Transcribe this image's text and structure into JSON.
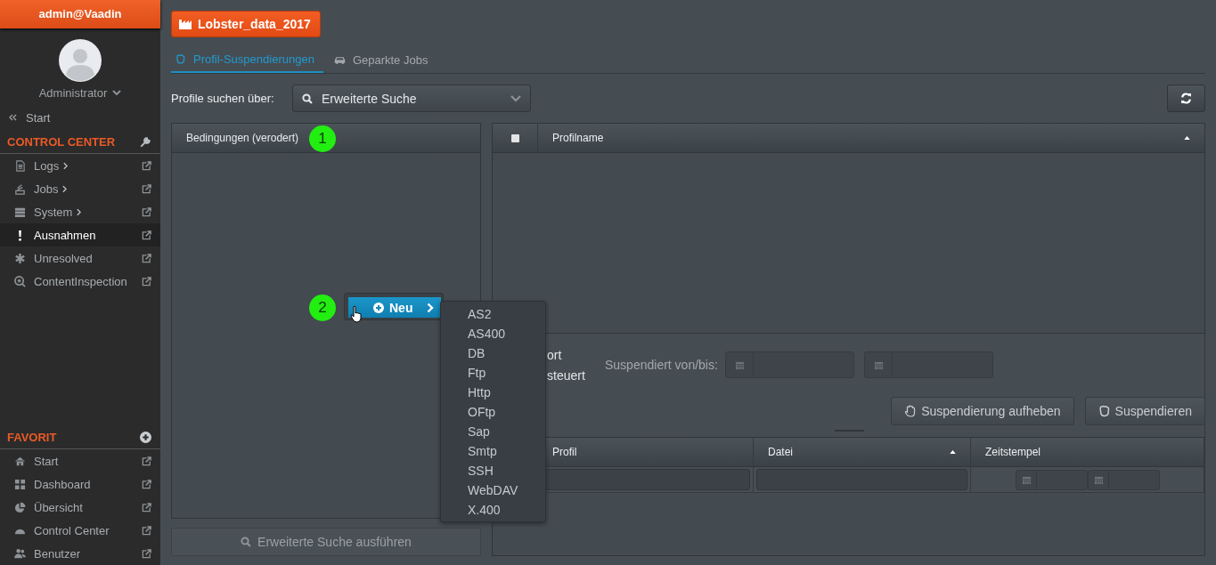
{
  "sidebar": {
    "user": "admin@Vaadin",
    "role": "Administrator",
    "back": "Start",
    "sections": [
      {
        "title": "CONTROL CENTER",
        "kind": "tools",
        "items": [
          {
            "label": "Logs",
            "submenu": true,
            "selected": false
          },
          {
            "label": "Jobs",
            "submenu": true,
            "selected": false
          },
          {
            "label": "System",
            "submenu": true,
            "selected": false
          },
          {
            "label": "Ausnahmen",
            "submenu": false,
            "selected": true
          },
          {
            "label": "Unresolved",
            "submenu": false,
            "selected": false
          },
          {
            "label": "ContentInspection",
            "submenu": false,
            "selected": false
          }
        ]
      },
      {
        "title": "FAVORIT",
        "kind": "favorites",
        "items": [
          {
            "label": "Start",
            "submenu": false,
            "selected": false
          },
          {
            "label": "Dashboard",
            "submenu": false,
            "selected": false
          },
          {
            "label": "Übersicht",
            "submenu": false,
            "selected": false
          },
          {
            "label": "Control Center",
            "submenu": false,
            "selected": false
          },
          {
            "label": "Benutzer",
            "submenu": false,
            "selected": false
          }
        ]
      }
    ]
  },
  "org_button": "Lobster_data_2017",
  "tabs": [
    {
      "label": "Profil-Suspendierungen",
      "selected": true
    },
    {
      "label": "Geparkte Jobs",
      "selected": false
    }
  ],
  "search": {
    "label": "Profile suchen über:",
    "value": "Erweiterte Suche"
  },
  "conditions": {
    "header": "Bedingungen (verodert)",
    "badge": "1",
    "new_button": "Neu",
    "new_badge": "2",
    "run_button": "Erweiterte Suche ausführen"
  },
  "menu": [
    "AS2",
    "AS400",
    "DB",
    "Ftp",
    "Http",
    "OFtp",
    "Sap",
    "Smtp",
    "SSH",
    "WebDAV",
    "X.400"
  ],
  "profiles_table": {
    "checked": false,
    "columns": [
      {
        "label": "Profilname",
        "sorted": true
      }
    ]
  },
  "options": {
    "radio_1": "ort",
    "radio_2": "steuert",
    "date_label": "Suspendiert von/bis:"
  },
  "buttons": [
    "Suspendierung aufheben",
    "Suspendieren"
  ],
  "jobs_table": {
    "columns": [
      {
        "label": "Profil",
        "sorted": false
      },
      {
        "label": "Datei",
        "sorted": true
      },
      {
        "label": "Zeitstempel",
        "sorted": false
      }
    ]
  }
}
